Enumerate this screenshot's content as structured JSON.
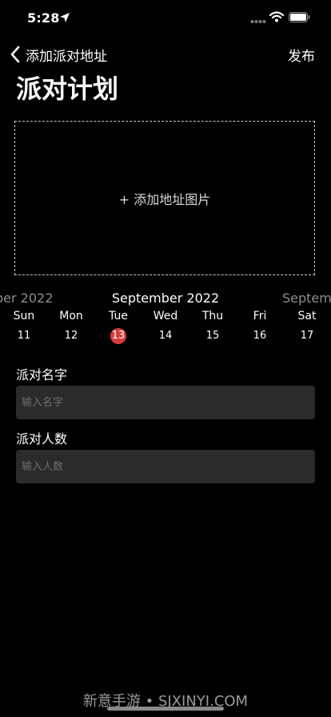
{
  "status_bar": {
    "time": "5:28",
    "icons": [
      "location-arrow-icon",
      "cellular-dots-icon",
      "wifi-icon",
      "battery-icon"
    ]
  },
  "nav": {
    "back_label": "添加派对地址",
    "publish_label": "发布"
  },
  "page": {
    "title": "派对计划"
  },
  "upload": {
    "label": "+ 添加地址图片"
  },
  "calendar": {
    "prev_month_partial": "ber 2022",
    "current_month": "September 2022",
    "next_month_partial": "Septemb",
    "days": [
      {
        "name": "Sun",
        "number": "11",
        "selected": false
      },
      {
        "name": "Mon",
        "number": "12",
        "selected": false
      },
      {
        "name": "Tue",
        "number": "13",
        "selected": true
      },
      {
        "name": "Wed",
        "number": "14",
        "selected": false
      },
      {
        "name": "Thu",
        "number": "15",
        "selected": false
      },
      {
        "name": "Fri",
        "number": "16",
        "selected": false
      },
      {
        "name": "Sat",
        "number": "17",
        "selected": false
      }
    ],
    "selected_color": "#d93a3a"
  },
  "form": {
    "party_name": {
      "label": "派对名字",
      "placeholder": "输入名字",
      "value": ""
    },
    "party_count": {
      "label": "派对人数",
      "placeholder": "输入人数",
      "value": ""
    }
  },
  "watermark": "新意手游 • SJXINYI.COM",
  "colors": {
    "background": "#000000",
    "input_background": "#2b2b2b",
    "muted_text": "#8e8e8e"
  }
}
